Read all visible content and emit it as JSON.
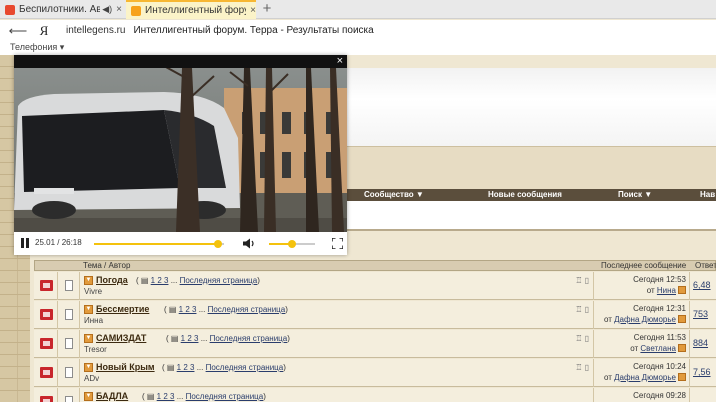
{
  "browser": {
    "tabs": [
      {
        "label": "Беспилотники. Автом",
        "audio_icon": "speaker-icon",
        "active": false
      },
      {
        "label": "Интеллигентный форум",
        "active": true
      }
    ],
    "new_tab_label": "+",
    "address": {
      "domain": "intellegens.ru",
      "page_title": "Интеллигентный форум. Терра - Результаты поиска"
    },
    "bookmarks": [
      {
        "label": "Телефония ▾"
      }
    ]
  },
  "player": {
    "time_display": "25.01 / 26:18",
    "progress": 0.953,
    "volume": 0.5,
    "close_label": "×"
  },
  "forum": {
    "nav": [
      "Сообщество ▼",
      "Новые сообщения",
      "Поиск ▼",
      "Нав"
    ],
    "table_headers": {
      "topic": "Тема / Автор",
      "last": "Последнее сообщение",
      "replies": "Ответ"
    },
    "last_page_label": "Последняя страница",
    "rows": [
      {
        "title": "Погода",
        "pages": "1 2 3",
        "author": "Vivre",
        "last_time": "Сегодня 12:53",
        "last_by_prefix": "от",
        "last_by": "Нина",
        "count": "6,48"
      },
      {
        "title": "Бессмертие",
        "pages": "1 2 3",
        "author": "Инна",
        "last_time": "Сегодня 12:31",
        "last_by_prefix": "от",
        "last_by": "Дафна Дюморье",
        "count": "753"
      },
      {
        "title": "САМИЗДАТ",
        "pages": "1 2 3",
        "author": "Tresor",
        "last_time": "Сегодня 11:53",
        "last_by_prefix": "от",
        "last_by": "Светлана",
        "count": "884"
      },
      {
        "title": "Новый Крым",
        "pages": "1 2 3",
        "author": "ADv",
        "last_time": "Сегодня 10:24",
        "last_by_prefix": "от",
        "last_by": "Дафна Дюморье",
        "count": "7,56"
      },
      {
        "title": "БАДЛА",
        "pages": "1 2 3",
        "author": "",
        "last_time": "Сегодня 09:28",
        "last_by_prefix": "",
        "last_by": "",
        "count": ""
      }
    ]
  }
}
